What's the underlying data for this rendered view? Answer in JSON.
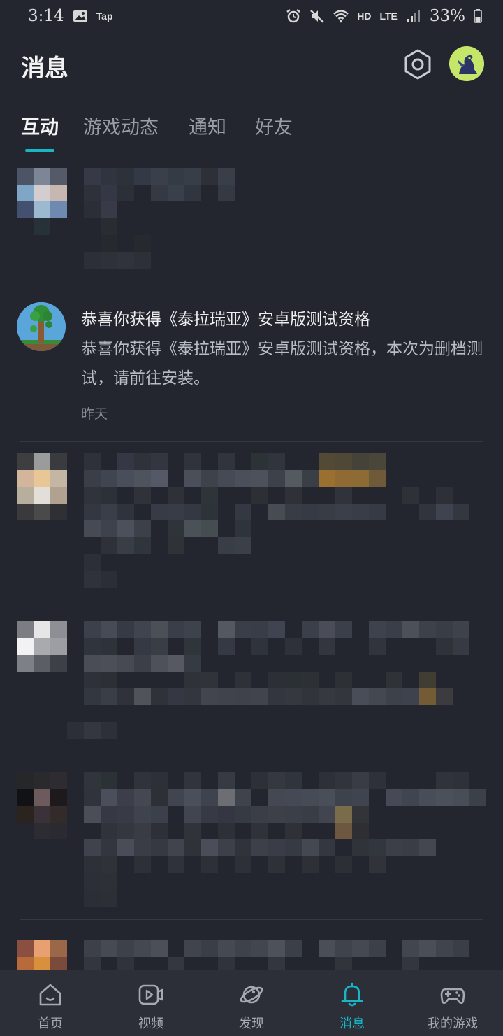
{
  "status_bar": {
    "time": "3:14",
    "app_tag": "Tap",
    "network": "HD",
    "lte": "LTE",
    "battery": "33%"
  },
  "header": {
    "title": "消息",
    "settings_icon": "hexagon-settings-icon",
    "avatar_icon": "user-avatar"
  },
  "tabs": [
    {
      "label": "互动",
      "active": true
    },
    {
      "label": "游戏动态",
      "active": false
    },
    {
      "label": "通知",
      "active": false
    },
    {
      "label": "好友",
      "active": false
    }
  ],
  "messages": {
    "visible_item": {
      "title": "恭喜你获得《泰拉瑞亚》安卓版测试资格",
      "body": "恭喜你获得《泰拉瑞亚》安卓版测试资格，本次为删档测试，请前往安装。",
      "time": "昨天",
      "avatar": "terraria-tree-icon"
    }
  },
  "bottom_nav": [
    {
      "label": "首页",
      "icon": "home-icon",
      "active": false
    },
    {
      "label": "视频",
      "icon": "video-icon",
      "active": false
    },
    {
      "label": "发现",
      "icon": "planet-icon",
      "active": false
    },
    {
      "label": "消息",
      "icon": "bell-icon",
      "active": true
    },
    {
      "label": "我的游戏",
      "icon": "gamepad-icon",
      "active": false
    }
  ],
  "colors": {
    "background": "#23262f",
    "accent": "#18b7c6",
    "nav_background": "#2c2f38"
  }
}
